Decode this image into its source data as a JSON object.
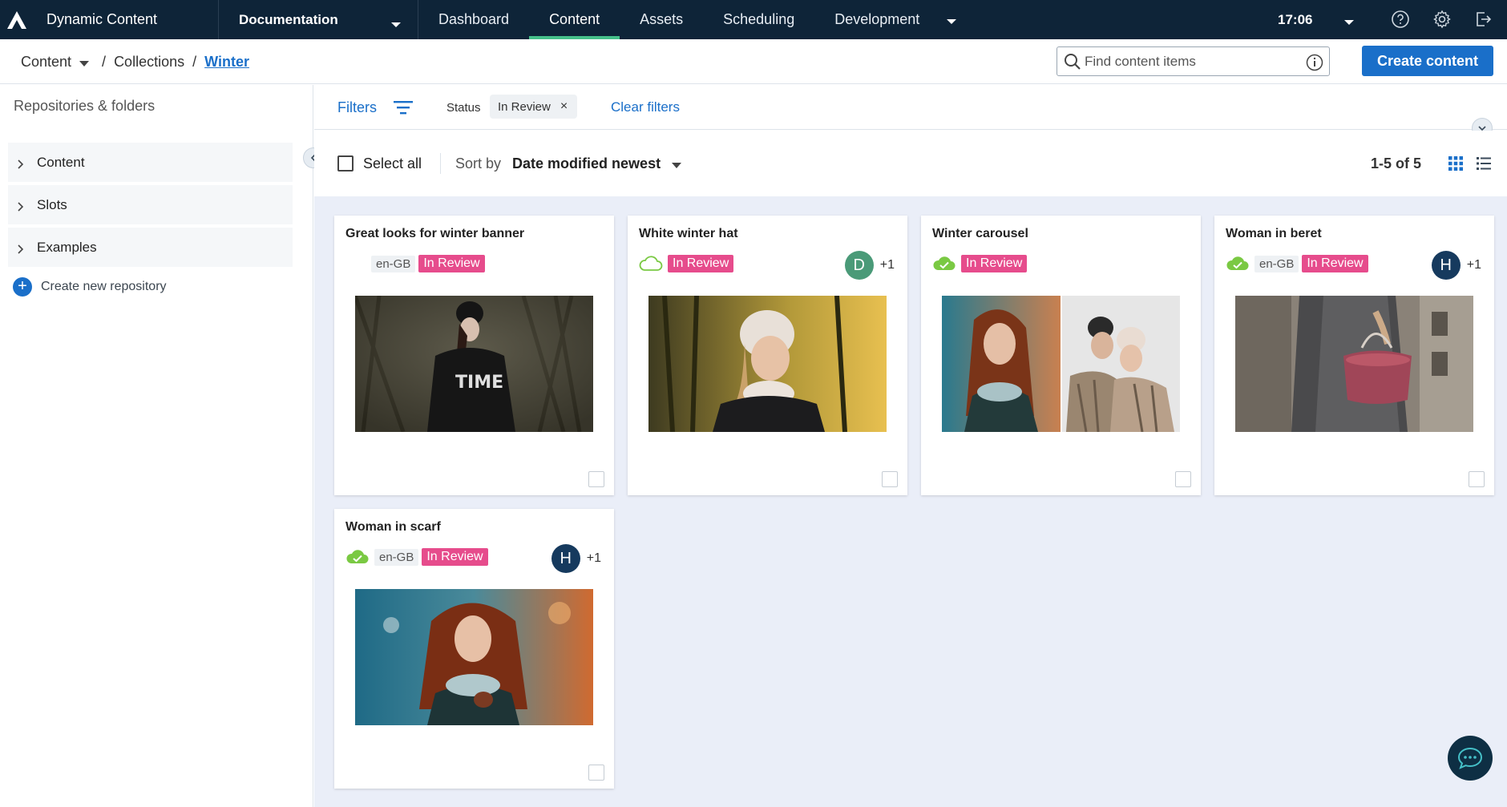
{
  "app": {
    "title": "Dynamic Content",
    "logo_icon": "amplience-logo-icon"
  },
  "hub": {
    "label": "Documentation"
  },
  "nav": {
    "tabs": [
      {
        "label": "Dashboard"
      },
      {
        "label": "Content"
      },
      {
        "label": "Assets"
      },
      {
        "label": "Scheduling"
      },
      {
        "label": "Development"
      }
    ],
    "active_tab": "Content"
  },
  "clock": {
    "time": "17:06"
  },
  "breadcrumb": {
    "root": "Content",
    "sep1": "/",
    "middle": "Collections",
    "sep2": "/",
    "current": "Winter"
  },
  "search": {
    "placeholder": "Find content items"
  },
  "create_button": {
    "label": "Create content"
  },
  "sidebar": {
    "title": "Repositories & folders",
    "items": [
      {
        "label": "Content"
      },
      {
        "label": "Slots"
      },
      {
        "label": "Examples"
      }
    ],
    "new_repo_label": "Create new repository"
  },
  "filters": {
    "label": "Filters",
    "status_label": "Status",
    "chip_value": "In Review",
    "clear_label": "Clear filters"
  },
  "toolbar": {
    "select_all": "Select all",
    "sort_label": "Sort by",
    "sort_value": "Date modified newest",
    "count": "1-5 of 5"
  },
  "colors": {
    "topbar": "#0e2438",
    "accent": "#1a6fc9",
    "status_in_review": "#e64c8c",
    "published_cloud": "#7ac943",
    "content_bg": "#eaeef8"
  },
  "cards": [
    {
      "title": "Great looks for winter banner",
      "cloud": "none",
      "locale": "en-GB",
      "status": "In Review",
      "avatar": "",
      "extra": ""
    },
    {
      "title": "White winter hat",
      "cloud": "outline",
      "locale": "",
      "status": "In Review",
      "avatar": "D",
      "extra": "+1"
    },
    {
      "title": "Winter carousel",
      "cloud": "published",
      "locale": "",
      "status": "In Review",
      "avatar": "",
      "extra": ""
    },
    {
      "title": "Woman in beret",
      "cloud": "published",
      "locale": "en-GB",
      "status": "In Review",
      "avatar": "H",
      "extra": "+1"
    },
    {
      "title": "Woman in scarf",
      "cloud": "published",
      "locale": "en-GB",
      "status": "In Review",
      "avatar": "H",
      "extra": "+1"
    }
  ]
}
